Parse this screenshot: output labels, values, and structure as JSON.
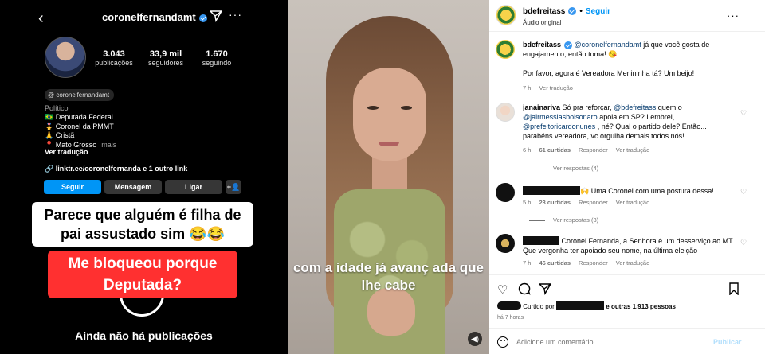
{
  "left": {
    "username": "coronelfernandamt",
    "stats": [
      {
        "num": "3.043",
        "label": "publicações"
      },
      {
        "num": "33,9 mil",
        "label": "seguidores"
      },
      {
        "num": "1.670",
        "label": "seguindo"
      }
    ],
    "threads_handle": "coronelfernandamt",
    "category": "Político",
    "bio_lines": [
      "🇧🇷 Deputada Federal",
      "🎖️ Coronel da PMMT",
      "🙏 Cristã",
      "📍 Mato Grosso"
    ],
    "bio_more": "mais",
    "translate": "Ver tradução",
    "link": "linktr.ee/coronelfernanda e 1 outro link",
    "buttons": {
      "follow": "Seguir",
      "message": "Mensagem",
      "call": "Ligar",
      "add": "+👤"
    },
    "caption_white": "Parece que alguém é filha de pai assustado sim 😂😂",
    "caption_red": "Me bloqueou porque Deputada?",
    "no_posts": "Ainda não há publicações"
  },
  "video": {
    "caption": "com a idade já avanç ada que lhe cabe",
    "sound_icon": "speaker-icon"
  },
  "right": {
    "header": {
      "username": "bdefreitass",
      "follow": "Seguir",
      "audio": "Áudio original",
      "more": "···"
    },
    "caption": {
      "user": "bdefreitass",
      "mention": "@coronelfernandamt",
      "text": " já que você gosta de engajamento, então toma! 😘",
      "text2": "Por favor, agora é Vereadora Menininha tá? Um beijo!",
      "time": "7 h",
      "translate": "Ver tradução"
    },
    "comments": [
      {
        "user": "janainariva",
        "text_a": " Só pra reforçar, ",
        "mention_a": "@bdefreitass",
        "text_b": " quem o ",
        "mention_b": "@jairmessiasbolsonaro",
        "text_c": " apoia em SP? Lembrei, ",
        "mention_c": "@prefeitoricardonunes",
        "text_d": " , né? Qual o partido dele? Então... parabéns vereadora, vc orgulha demais todos nós!",
        "time": "6 h",
        "likes": "61 curtidas",
        "reply": "Responder",
        "translate": "Ver tradução",
        "replies": "Ver respostas (4)"
      },
      {
        "text": "🙌 Uma Coronel com uma postura dessa!",
        "time": "5 h",
        "likes": "23 curtidas",
        "reply": "Responder",
        "translate": "Ver tradução",
        "replies": "Ver respostas (3)"
      },
      {
        "text": "Coronel Fernanda, a Senhora é um desserviço ao MT. Que vergonha ter apoiado seu nome, na última eleição",
        "time": "7 h",
        "likes": "46 curtidas",
        "reply": "Responder",
        "translate": "Ver tradução"
      }
    ],
    "likes_prefix": "Curtido por",
    "likes_suffix": "e outras 1.913 pessoas",
    "time_ago": "há 7 horas",
    "add_comment_placeholder": "Adicione um comentário...",
    "post_label": "Publicar"
  }
}
